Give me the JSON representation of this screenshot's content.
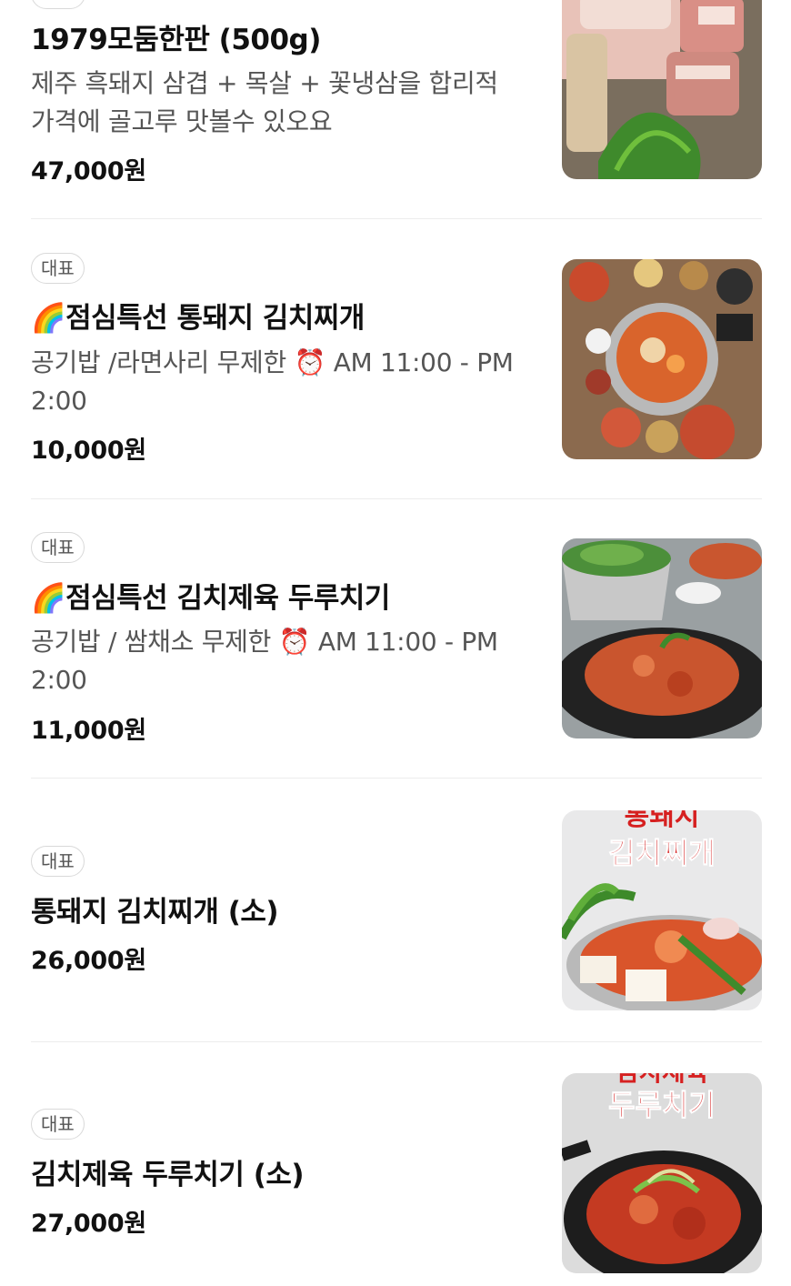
{
  "menu": {
    "items": [
      {
        "name": "1979모둠한판 (500g)",
        "description": "제주 흑돼지 삼겹 + 목살 + 꽃냉삼을 합리적 가격에 골고루 맛볼수 있오요",
        "price": "47,000원",
        "image_icon": "pork-platter-photo"
      },
      {
        "badge": "대표",
        "name": "🌈점심특선 통돼지 김치찌개",
        "description": "공기밥 /라면사리 무제한 ⏰ AM 11:00 - PM 2:00",
        "price": "10,000원",
        "image_icon": "kimchi-stew-set-photo"
      },
      {
        "badge": "대표",
        "name": "🌈점심특선 김치제육 두루치기",
        "description": "공기밥 / 쌈채소 무제한 ⏰ AM 11:00 - PM 2:00",
        "price": "11,000원",
        "image_icon": "spicy-pork-set-photo"
      },
      {
        "badge": "대표",
        "name": "통돼지 김치찌개 (소)",
        "price": "26,000원",
        "image_icon": "kimchi-stew-poster",
        "image_text": "김치찌개",
        "image_text_top": "통돼지"
      },
      {
        "badge": "대표",
        "name": "김치제육 두루치기 (소)",
        "price": "27,000원",
        "image_icon": "spicy-pork-poster",
        "image_text": "두루치기",
        "image_text_top": "김치제육"
      }
    ]
  }
}
